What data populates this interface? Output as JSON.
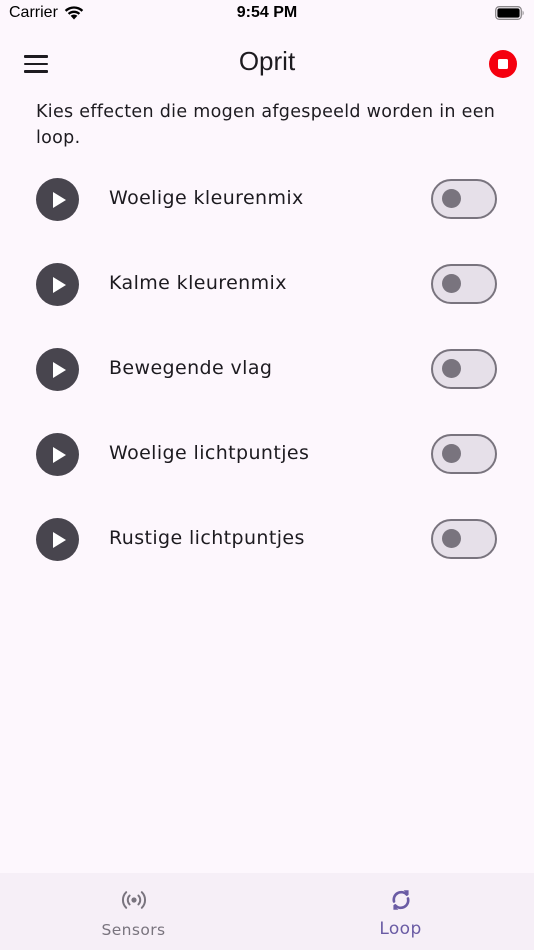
{
  "status_bar": {
    "carrier": "Carrier",
    "time": "9:54 PM"
  },
  "app_bar": {
    "title": "Oprit",
    "menu_icon": "hamburger-menu-icon",
    "stop_icon": "stop-circle-icon",
    "stop_color": "#f5000f"
  },
  "intro_text": "Kies effecten die mogen afgespeeld worden in een loop.",
  "effects": [
    {
      "label": "Woelige kleurenmix",
      "enabled": false
    },
    {
      "label": "Kalme kleurenmix",
      "enabled": false
    },
    {
      "label": "Bewegende vlag",
      "enabled": false
    },
    {
      "label": "Woelige lichtpuntjes",
      "enabled": false
    },
    {
      "label": "Rustige lichtpuntjes",
      "enabled": false
    }
  ],
  "bottom_nav": {
    "items": [
      {
        "label": "Sensors",
        "icon": "sensors-icon",
        "active": false
      },
      {
        "label": "Loop",
        "icon": "loop-sync-icon",
        "active": true
      }
    ],
    "active_color": "#6a5ba4",
    "inactive_color": "#79747e"
  }
}
